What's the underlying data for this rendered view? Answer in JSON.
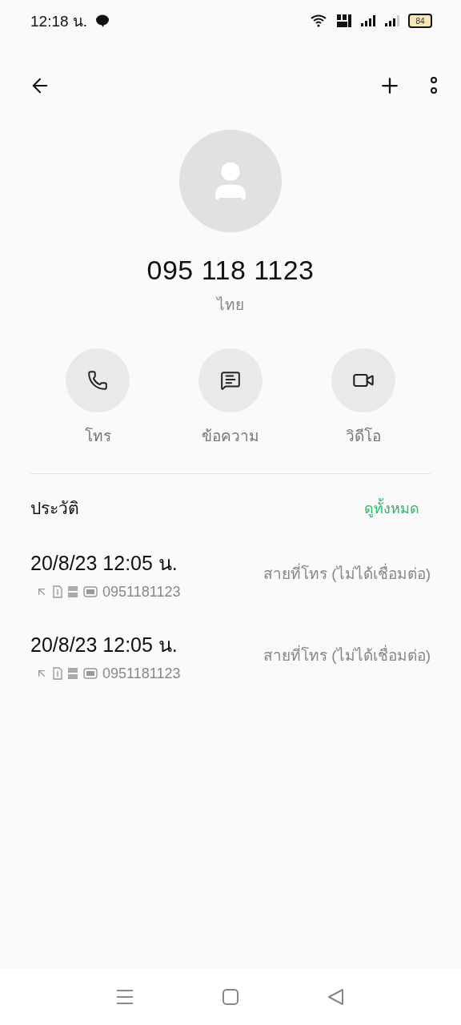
{
  "status_bar": {
    "time": "12:18 น.",
    "battery": "84"
  },
  "contact": {
    "number": "095 118 1123",
    "location": "ไทย"
  },
  "actions": [
    {
      "kind": "call",
      "label": "โทร"
    },
    {
      "kind": "message",
      "label": "ข้อความ"
    },
    {
      "kind": "video",
      "label": "วิดีโอ"
    }
  ],
  "history": {
    "title": "ประวัติ",
    "see_all": "ดูทั้งหมด",
    "entries": [
      {
        "time": "20/8/23 12:05 น.",
        "number": "0951181123",
        "status": "สายที่โทร (ไม่ได้เชื่อมต่อ)"
      },
      {
        "time": "20/8/23 12:05 น.",
        "number": "0951181123",
        "status": "สายที่โทร (ไม่ได้เชื่อมต่อ)"
      }
    ]
  }
}
